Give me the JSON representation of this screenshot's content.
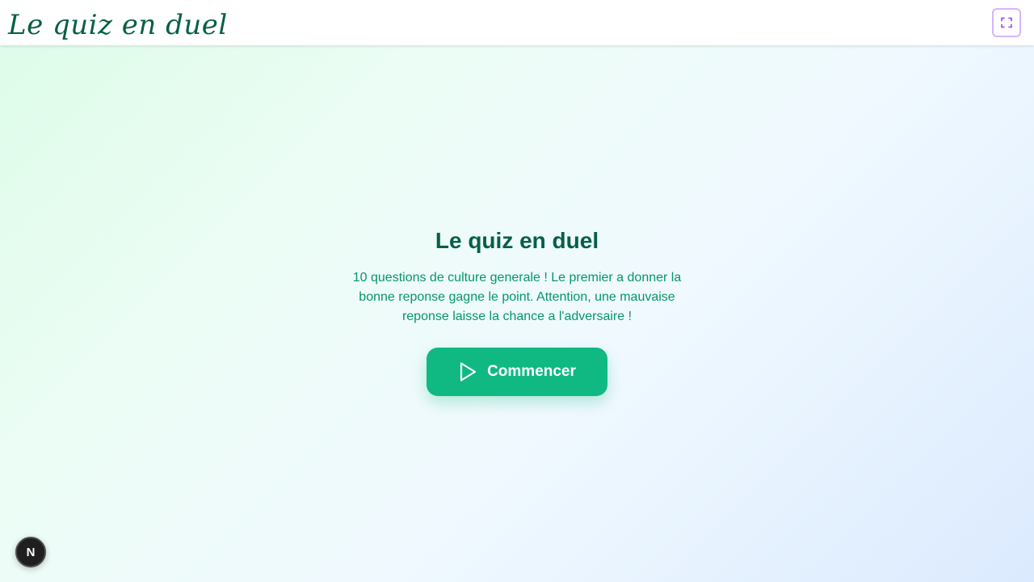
{
  "header": {
    "logo_text": "Le quiz en duel",
    "fullscreen_icon": "fullscreen-icon"
  },
  "main": {
    "title": "Le quiz en duel",
    "description": "10 questions de culture generale ! Le premier a donner la bonne reponse gagne le point. Attention, une mauvaise reponse laisse la chance a l'adversaire !",
    "start_button": {
      "label": "Commencer",
      "icon": "play-icon"
    }
  },
  "dev_badge": {
    "label": "N"
  },
  "colors": {
    "brand_dark_green": "#065f46",
    "text_green": "#059669",
    "button_green": "#10b981",
    "fullscreen_border": "#d8b4fe",
    "fullscreen_icon": "#a855f7"
  }
}
